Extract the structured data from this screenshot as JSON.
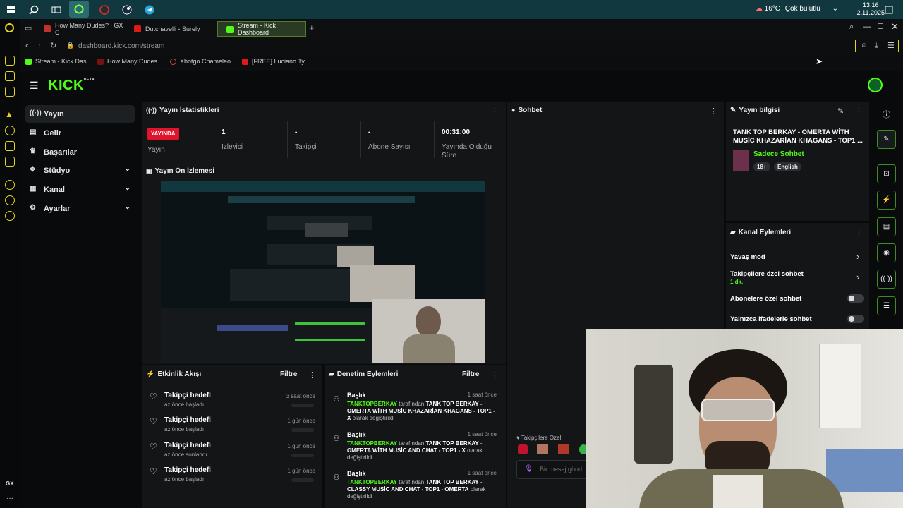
{
  "taskbar": {
    "weather_temp": "16°C",
    "weather_desc": "Çok bulutlu",
    "time": "13:16",
    "date": "2.11.2025"
  },
  "browser": {
    "tabs": [
      {
        "label": "How Many Dudes? | GX C"
      },
      {
        "label": "Dutchavelli - Surely"
      },
      {
        "label": "Stream - Kick Dashboard"
      }
    ],
    "url": "dashboard.kick.com/stream",
    "bookmarks": [
      {
        "label": "Stream - Kick Das..."
      },
      {
        "label": "How Many Dudes..."
      },
      {
        "label": "Xbotgo Chameleo..."
      },
      {
        "label": "[FREE] Luciano Ty..."
      }
    ]
  },
  "sidebar": {
    "logo": "KICK",
    "logo_badge": "BETA",
    "items": [
      {
        "label": "Yayın"
      },
      {
        "label": "Gelir"
      },
      {
        "label": "Başarılar"
      },
      {
        "label": "Stüdyo"
      },
      {
        "label": "Kanal"
      },
      {
        "label": "Ayarlar"
      }
    ]
  },
  "stats": {
    "title": "Yayın İstatistikleri",
    "live_badge": "YAYINDA",
    "live_label": "Yayın",
    "viewers_value": "1",
    "viewers_label": "İzleyici",
    "followers_value": "-",
    "followers_label": "Takipçi",
    "subs_value": "-",
    "subs_label": "Abone Sayısı",
    "uptime_value": "00:31:00",
    "uptime_label": "Yayında Olduğu Süre"
  },
  "preview": {
    "title": "Yayın Ön İzlemesi"
  },
  "chat": {
    "title": "Sohbet",
    "followers_only": "Takipçilere Özel",
    "input_placeholder": "Bir mesaj gönd"
  },
  "events": {
    "title": "Etkinlik Akışı",
    "filter": "Filtre",
    "rows": [
      {
        "title": "Takipçi hedefi",
        "sub": "az önce başladı",
        "time": "3 saat önce"
      },
      {
        "title": "Takipçi hedefi",
        "sub": "az önce başladı",
        "time": "1 gün önce"
      },
      {
        "title": "Takipçi hedefi",
        "sub": "az önce sonlandı",
        "time": "1 gün önce"
      },
      {
        "title": "Takipçi hedefi",
        "sub": "az önce başladı",
        "time": "1 gün önce"
      }
    ]
  },
  "moderation": {
    "title": "Denetim Eylemleri",
    "filter": "Filtre",
    "rows": [
      {
        "title": "Başlık",
        "time": "1 saat önce",
        "user": "TANKTOPBERKAY",
        "by": "tarafından",
        "value": "TANK TOP BERKAY - OMERTA WİTH MUSİC KHAZARİAN KHAGANS - TOP1 - X",
        "suffix": "olarak değiştirildi"
      },
      {
        "title": "Başlık",
        "time": "1 saat önce",
        "user": "TANKTOPBERKAY",
        "by": "tarafından",
        "value": "TANK TOP BERKAY - OMERTA WİTH MUSİC AND CHAT - TOP1 - X",
        "suffix": "olarak değiştirildi"
      },
      {
        "title": "Başlık",
        "time": "1 saat önce",
        "user": "TANKTOPBERKAY",
        "by": "tarafından",
        "value": "TANK TOP BERKAY - CLASSY MUSİC AND CHAT - TOP1 - OMERTA",
        "suffix": "olarak değiştirildi"
      }
    ]
  },
  "stream_info": {
    "title": "Yayın bilgisi",
    "stream_title": "TANK TOP BERKAY - OMERTA WİTH MUSİC KHAZARİAN KHAGANS - TOP1 ...",
    "category": "Sadece Sohbet",
    "tags": [
      "18+",
      "English"
    ]
  },
  "channel_actions": {
    "title": "Kanal Eylemleri",
    "slow_mode": "Yavaş mod",
    "followers_chat": "Takipçilere özel sohbet",
    "followers_chat_value": "1 dk.",
    "subs_chat": "Abonelere özel sohbet",
    "emote_chat": "Yalnızca ifadelerle sohbet"
  },
  "colors": {
    "kick_green": "#53fc18",
    "live_red": "#e1142e"
  }
}
